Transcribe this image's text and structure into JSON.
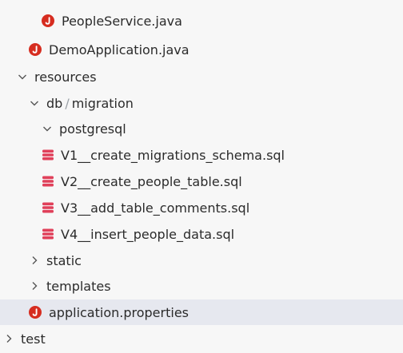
{
  "tree": {
    "items": [
      {
        "label": "PeopleService.java",
        "icon": "java-file-icon"
      },
      {
        "label": "DemoApplication.java",
        "icon": "java-file-icon"
      },
      {
        "label": "resources",
        "icon": "chevron-down-icon"
      },
      {
        "label_a": "db",
        "sep": "/",
        "label_b": "migration",
        "icon": "chevron-down-icon"
      },
      {
        "label": "postgresql",
        "icon": "chevron-down-icon"
      },
      {
        "label": "V1__create_migrations_schema.sql",
        "icon": "sql-file-icon"
      },
      {
        "label": "V2__create_people_table.sql",
        "icon": "sql-file-icon"
      },
      {
        "label": "V3__add_table_comments.sql",
        "icon": "sql-file-icon"
      },
      {
        "label": "V4__insert_people_data.sql",
        "icon": "sql-file-icon"
      },
      {
        "label": "static",
        "icon": "chevron-right-icon"
      },
      {
        "label": "templates",
        "icon": "chevron-right-icon"
      },
      {
        "label": "application.properties",
        "icon": "properties-file-icon",
        "selected": true
      },
      {
        "label": "test",
        "icon": "chevron-right-icon"
      }
    ]
  },
  "colors": {
    "background": "#f7f7f7",
    "selected_row": "#e6e8ef",
    "java_icon": "#d62d20",
    "sql_icon": "#e0405a",
    "text": "#2b2b2b"
  }
}
